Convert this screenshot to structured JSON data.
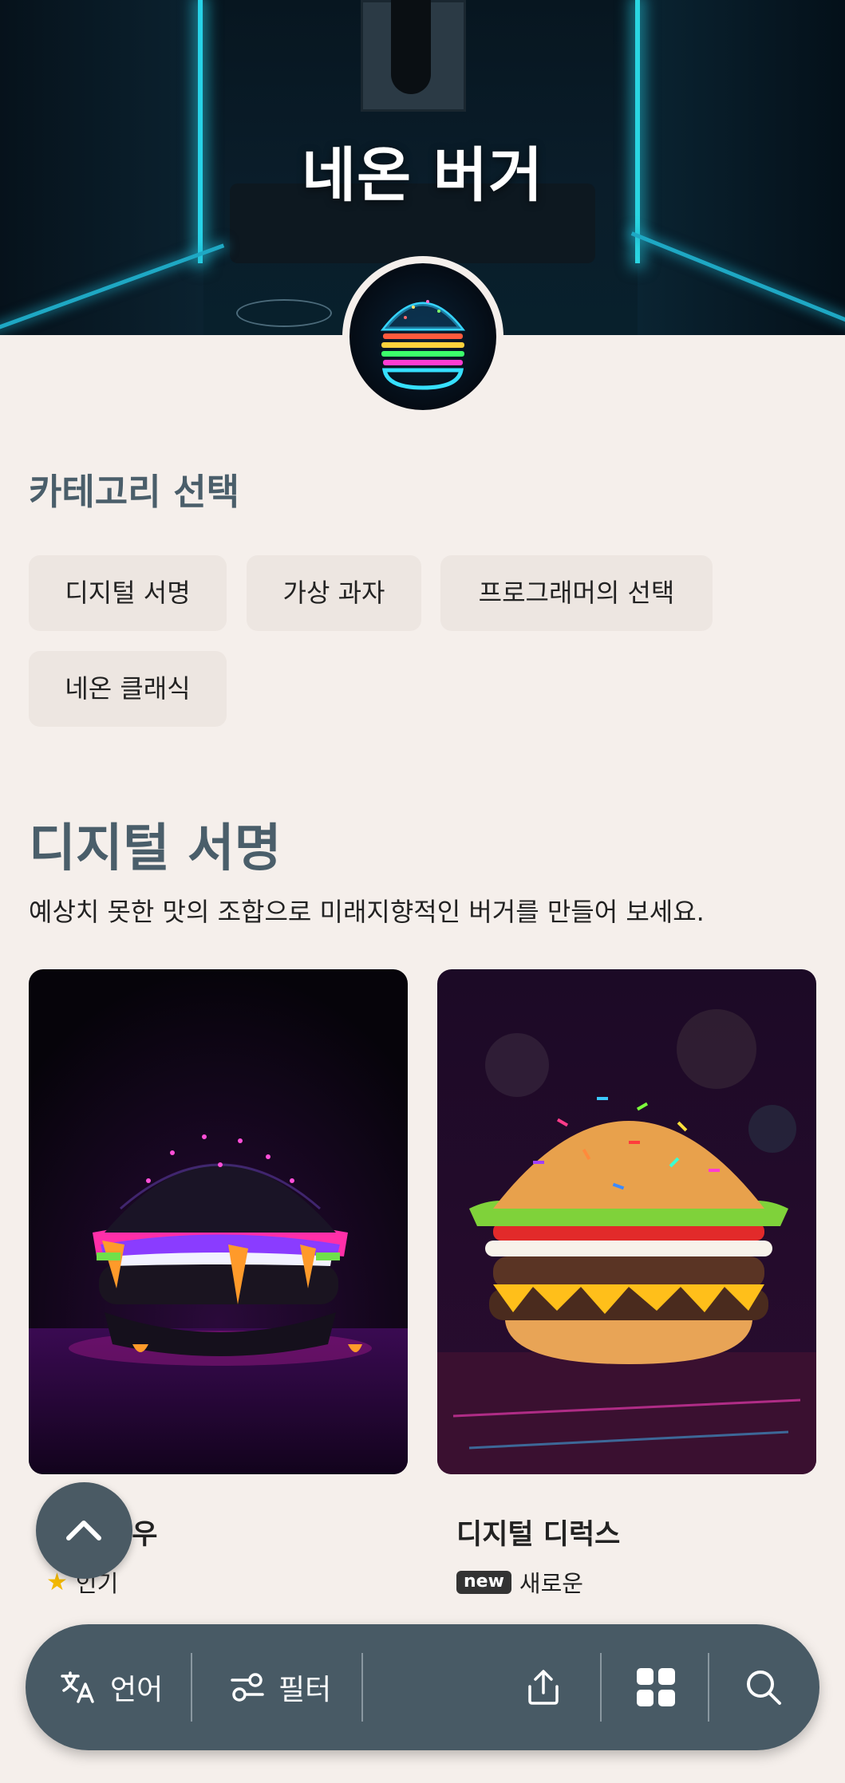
{
  "hero": {
    "title": "네온 버거"
  },
  "categories": {
    "heading": "카테고리 선택",
    "chips": [
      "디지털 서명",
      "가상 과자",
      "프로그래머의 선택",
      "네온 클래식"
    ]
  },
  "section": {
    "title": "디지털 서명",
    "description": "예상치 못한 맛의 조합으로 미래지향적인 버거를 만들어 보세요."
  },
  "cards": [
    {
      "title": "로우",
      "badge_icon": "star-icon",
      "badge_text": "인기",
      "image": "black-bun-neon-burger-photo"
    },
    {
      "title": "디지털 디럭스",
      "badge_icon": "new",
      "badge_text": "새로운",
      "image": "rainbow-sprinkle-burger-photo"
    }
  ],
  "bottom_bar": {
    "language_label": "언어",
    "filter_label": "필터",
    "icons": [
      "translate-icon",
      "filter-icon",
      "share-icon",
      "grid-icon",
      "search-icon"
    ]
  },
  "colors": {
    "background": "#f5efeb",
    "accent": "#4a5e6a",
    "bar": "#485a65",
    "chip": "#ede6e1"
  }
}
